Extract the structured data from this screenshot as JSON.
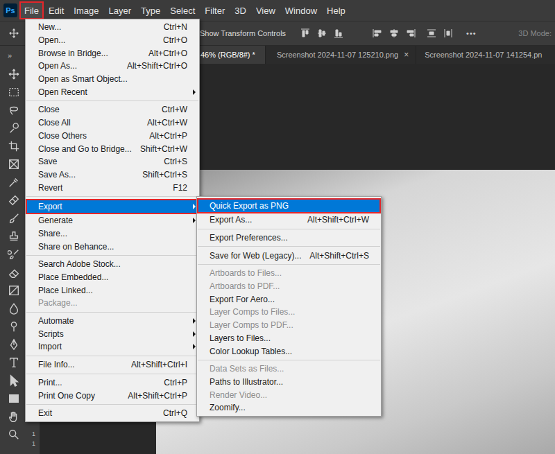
{
  "app": {
    "logo": "Ps"
  },
  "menubar": [
    {
      "label": "File",
      "selected": true
    },
    {
      "label": "Edit",
      "selected": false
    },
    {
      "label": "Image",
      "selected": false
    },
    {
      "label": "Layer",
      "selected": false
    },
    {
      "label": "Type",
      "selected": false
    },
    {
      "label": "Select",
      "selected": false
    },
    {
      "label": "Filter",
      "selected": false
    },
    {
      "label": "3D",
      "selected": false
    },
    {
      "label": "View",
      "selected": false
    },
    {
      "label": "Window",
      "selected": false
    },
    {
      "label": "Help",
      "selected": false
    }
  ],
  "options_bar": {
    "label": "Show Transform Controls",
    "more": "•••",
    "mode_label": "3D Mode:",
    "mode_disabled": true
  },
  "tool_panel": {
    "expand": "»"
  },
  "tab_close": "×",
  "tabs": [
    {
      "label": "46% (RGB/8#) *",
      "selected": true,
      "closable": false
    },
    {
      "label": "Screenshot 2024-11-07 125210.png",
      "selected": false,
      "closable": true
    },
    {
      "label": "Screenshot 2024-11-07 141254.pn",
      "selected": false,
      "closable": false
    }
  ],
  "ruler": {
    "marks": [
      "1",
      "1"
    ]
  },
  "file_menu": {
    "groups": [
      [
        {
          "label": "New...",
          "shortcut": "Ctrl+N",
          "submenu": false,
          "disabled": false,
          "selected": false
        },
        {
          "label": "Open...",
          "shortcut": "Ctrl+O",
          "submenu": false,
          "disabled": false,
          "selected": false
        },
        {
          "label": "Browse in Bridge...",
          "shortcut": "Alt+Ctrl+O",
          "submenu": false,
          "disabled": false,
          "selected": false
        },
        {
          "label": "Open As...",
          "shortcut": "Alt+Shift+Ctrl+O",
          "submenu": false,
          "disabled": false,
          "selected": false
        },
        {
          "label": "Open as Smart Object...",
          "submenu": false,
          "disabled": false,
          "selected": false
        },
        {
          "label": "Open Recent",
          "submenu": true,
          "disabled": false,
          "selected": false
        }
      ],
      [
        {
          "label": "Close",
          "shortcut": "Ctrl+W",
          "submenu": false,
          "disabled": false,
          "selected": false
        },
        {
          "label": "Close All",
          "shortcut": "Alt+Ctrl+W",
          "submenu": false,
          "disabled": false,
          "selected": false
        },
        {
          "label": "Close Others",
          "shortcut": "Alt+Ctrl+P",
          "submenu": false,
          "disabled": false,
          "selected": false
        },
        {
          "label": "Close and Go to Bridge...",
          "shortcut": "Shift+Ctrl+W",
          "submenu": false,
          "disabled": false,
          "selected": false
        },
        {
          "label": "Save",
          "shortcut": "Ctrl+S",
          "submenu": false,
          "disabled": false,
          "selected": false
        },
        {
          "label": "Save As...",
          "shortcut": "Shift+Ctrl+S",
          "submenu": false,
          "disabled": false,
          "selected": false
        },
        {
          "label": "Revert",
          "shortcut": "F12",
          "submenu": false,
          "disabled": false,
          "selected": false
        }
      ],
      [
        {
          "label": "Export",
          "submenu": true,
          "disabled": false,
          "selected": true
        },
        {
          "label": "Generate",
          "submenu": true,
          "disabled": false,
          "selected": false
        },
        {
          "label": "Share...",
          "submenu": false,
          "disabled": false,
          "selected": false
        },
        {
          "label": "Share on Behance...",
          "submenu": false,
          "disabled": false,
          "selected": false
        }
      ],
      [
        {
          "label": "Search Adobe Stock...",
          "submenu": false,
          "disabled": false,
          "selected": false
        },
        {
          "label": "Place Embedded...",
          "submenu": false,
          "disabled": false,
          "selected": false
        },
        {
          "label": "Place Linked...",
          "submenu": false,
          "disabled": false,
          "selected": false
        },
        {
          "label": "Package...",
          "submenu": false,
          "disabled": true,
          "selected": false
        }
      ],
      [
        {
          "label": "Automate",
          "submenu": true,
          "disabled": false,
          "selected": false
        },
        {
          "label": "Scripts",
          "submenu": true,
          "disabled": false,
          "selected": false
        },
        {
          "label": "Import",
          "submenu": true,
          "disabled": false,
          "selected": false
        }
      ],
      [
        {
          "label": "File Info...",
          "shortcut": "Alt+Shift+Ctrl+I",
          "submenu": false,
          "disabled": false,
          "selected": false
        }
      ],
      [
        {
          "label": "Print...",
          "shortcut": "Ctrl+P",
          "submenu": false,
          "disabled": false,
          "selected": false
        },
        {
          "label": "Print One Copy",
          "shortcut": "Alt+Shift+Ctrl+P",
          "submenu": false,
          "disabled": false,
          "selected": false
        }
      ],
      [
        {
          "label": "Exit",
          "shortcut": "Ctrl+Q",
          "submenu": false,
          "disabled": false,
          "selected": false
        }
      ]
    ]
  },
  "export_submenu": {
    "groups": [
      [
        {
          "label": "Quick Export as PNG",
          "submenu": false,
          "disabled": false,
          "selected": true
        },
        {
          "label": "Export As...",
          "shortcut": "Alt+Shift+Ctrl+W",
          "submenu": false,
          "disabled": false,
          "selected": false
        }
      ],
      [
        {
          "label": "Export Preferences...",
          "submenu": false,
          "disabled": false,
          "selected": false
        }
      ],
      [
        {
          "label": "Save for Web (Legacy)...",
          "shortcut": "Alt+Shift+Ctrl+S",
          "submenu": false,
          "disabled": false,
          "selected": false
        }
      ],
      [
        {
          "label": "Artboards to Files...",
          "submenu": false,
          "disabled": true,
          "selected": false
        },
        {
          "label": "Artboards to PDF...",
          "submenu": false,
          "disabled": true,
          "selected": false
        },
        {
          "label": "Export For Aero...",
          "submenu": false,
          "disabled": false,
          "selected": false
        },
        {
          "label": "Layer Comps to Files...",
          "submenu": false,
          "disabled": true,
          "selected": false
        },
        {
          "label": "Layer Comps to PDF...",
          "submenu": false,
          "disabled": true,
          "selected": false
        },
        {
          "label": "Layers to Files...",
          "submenu": false,
          "disabled": false,
          "selected": false
        },
        {
          "label": "Color Lookup Tables...",
          "submenu": false,
          "disabled": false,
          "selected": false
        }
      ],
      [
        {
          "label": "Data Sets as Files...",
          "submenu": false,
          "disabled": true,
          "selected": false
        },
        {
          "label": "Paths to Illustrator...",
          "submenu": false,
          "disabled": false,
          "selected": false
        },
        {
          "label": "Render Video...",
          "submenu": false,
          "disabled": true,
          "selected": false
        },
        {
          "label": "Zoomify...",
          "submenu": false,
          "disabled": false,
          "selected": false
        }
      ]
    ]
  }
}
